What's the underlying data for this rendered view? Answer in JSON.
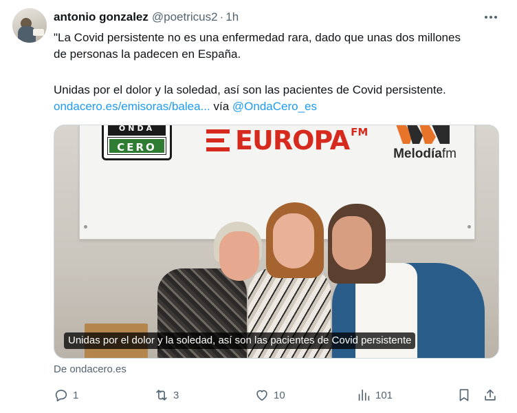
{
  "tweet": {
    "display_name": "antonio gonzalez",
    "handle": "@poetricus2",
    "separator": "·",
    "time": "1h",
    "text_line1": "\"La Covid persistente no es una enfermedad rara, dado que unas dos millones",
    "text_line2": "de personas la padecen en España.",
    "text_line3": "Unidas por el dolor y la soledad, así son las pacientes de Covid persistente.",
    "link_text": "ondacero.es/emisoras/balea...",
    "via_text": "vía",
    "mention": "@OndaCero_es"
  },
  "media": {
    "banner_onda_top": "ONDA",
    "banner_onda_bottom": "CERO",
    "banner_europa": "EUROPA",
    "banner_europa_fm": "FM",
    "banner_melodia": "Melodía",
    "banner_melodia_fm": "fm",
    "caption": "Unidas por el dolor y la soledad, así son las pacientes de Covid persistente"
  },
  "source": "De ondacero.es",
  "actions": {
    "reply_count": "1",
    "repost_count": "3",
    "like_count": "10",
    "views_count": "101"
  },
  "icons": {
    "reply": "reply-icon",
    "repost": "repost-icon",
    "like": "heart-icon",
    "views": "views-icon",
    "bookmark": "bookmark-icon",
    "share": "share-icon",
    "more": "more-icon"
  },
  "colors": {
    "text": "#0f1419",
    "secondary": "#536471",
    "link": "#1d9bf0",
    "border": "#cfd9de"
  }
}
